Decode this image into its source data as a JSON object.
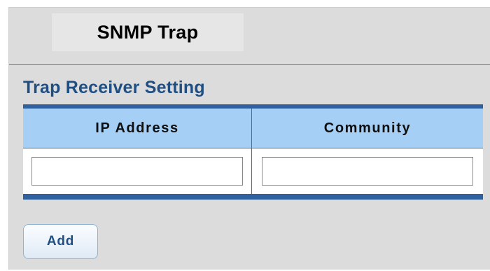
{
  "page": {
    "title": "SNMP Trap"
  },
  "section": {
    "title": "Trap Receiver Setting"
  },
  "table": {
    "columns": [
      "IP Address",
      "Community"
    ],
    "row": {
      "ip_address_value": "",
      "community_value": ""
    }
  },
  "actions": {
    "add_label": "Add"
  },
  "colors": {
    "panel_bg": "#dcdcdc",
    "section_title": "#1f4f82",
    "table_header_bg": "#a6cff5",
    "table_bar": "#2f61a0"
  }
}
